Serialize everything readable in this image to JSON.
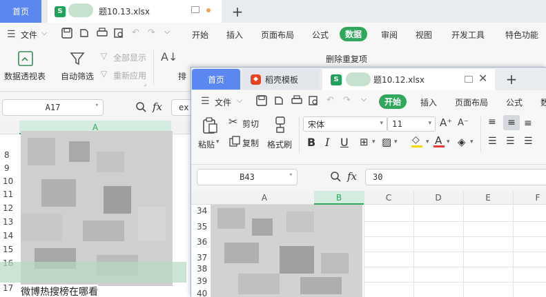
{
  "back": {
    "tabs": {
      "home": "首页",
      "file": "题10.13.xlsx",
      "new_tab": "+"
    },
    "menu": {
      "file": "文件",
      "items": [
        "开始",
        "插入",
        "页面布局",
        "公式",
        "数据",
        "审阅",
        "视图",
        "开发工具",
        "特色功能"
      ],
      "active": "数据"
    },
    "ribbon": {
      "pivot": "数据透视表",
      "autofilter": "自动筛选",
      "show_all": "全部显示",
      "reapply": "重新应用",
      "sort_partial": "排",
      "remove_dup": "删除重复项"
    },
    "namebox": "A17",
    "formula_partial": "ex",
    "col_a": "A",
    "rows": [
      "8",
      "9",
      "10",
      "11",
      "12",
      "13",
      "14",
      "15",
      "16",
      "17"
    ],
    "cell_text": "微博热搜榜在哪看"
  },
  "front": {
    "tabs": {
      "home": "首页",
      "template": "稻壳模板",
      "file": "题10.12.xlsx",
      "new_tab": "+"
    },
    "menu": {
      "file": "文件",
      "items": [
        "开始",
        "插入",
        "页面布局",
        "公式",
        "数"
      ],
      "active": "开始"
    },
    "ribbon": {
      "paste": "粘贴",
      "cut": "剪切",
      "copy": "复制",
      "format_painter": "格式刷",
      "font_name": "宋体",
      "font_size": "11"
    },
    "namebox": "B43",
    "formula_value": "30",
    "columns": [
      "A",
      "B",
      "C",
      "D",
      "E",
      "F"
    ],
    "rows": [
      "34",
      "35",
      "36",
      "37",
      "38",
      "39",
      "40"
    ]
  },
  "colors": {
    "accent_green": "#2fa85c",
    "home_tab": "#5a87f0",
    "selected_col": "#d5ece0"
  }
}
